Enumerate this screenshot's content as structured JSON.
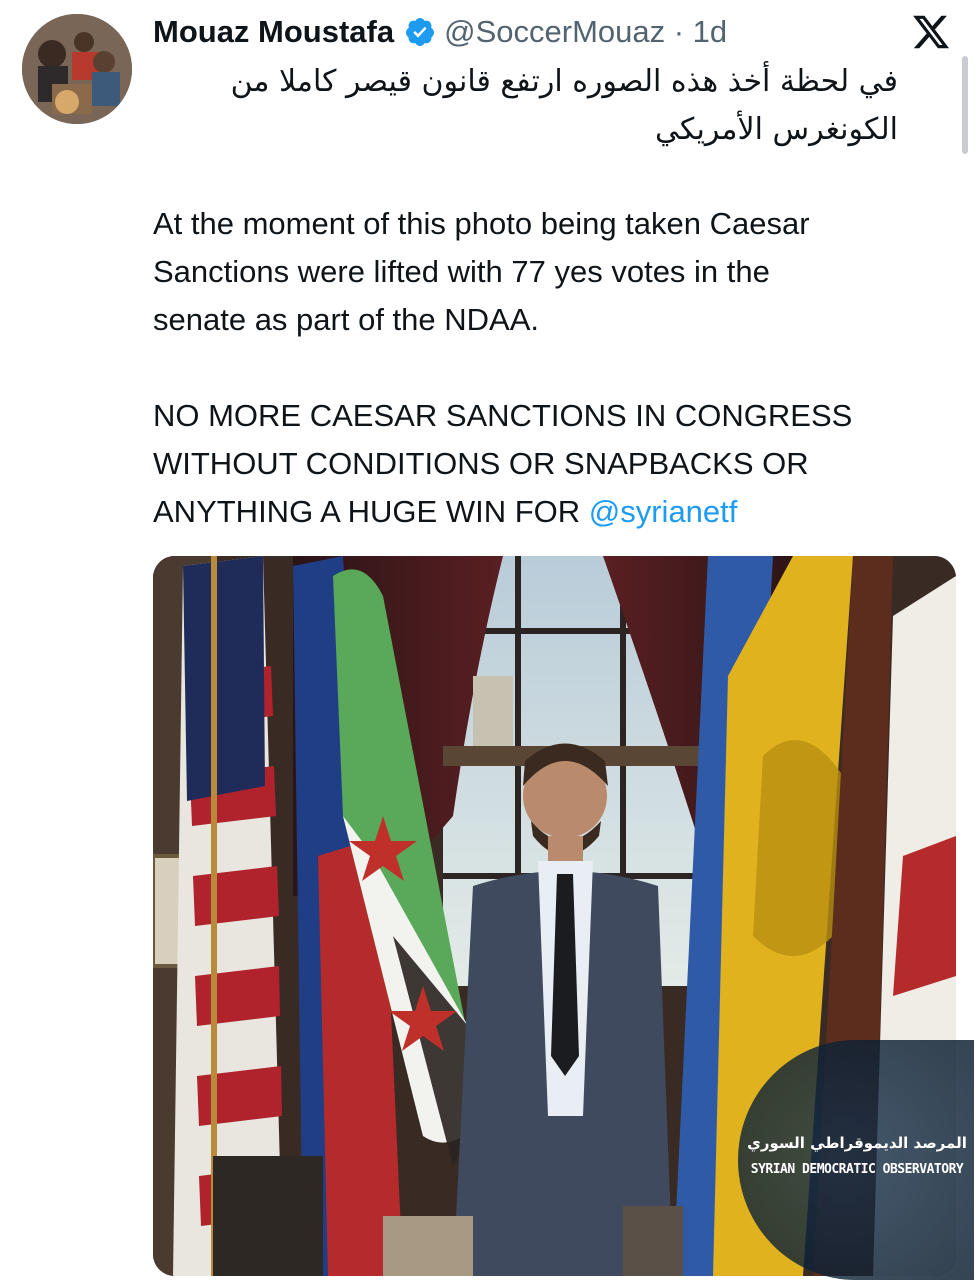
{
  "tweet": {
    "author_name": "Mouaz Moustafa",
    "handle_time": "@SoccerMouaz · 1d",
    "arabic_text": "في لحظة أخذ هذه الصوره ارتفع قانون قيصر كاملا من الكونغرس الأمريكي",
    "english_line_1": "At the moment of this photo being taken Caesar",
    "english_line_2": "Sanctions were lifted with 77 yes votes in the",
    "english_line_3": "senate as part of the NDAA.",
    "caps_line_1": "NO MORE CAESAR SANCTIONS IN CONGRESS",
    "caps_line_2": "WITHOUT CONDITIONS OR SNAPBACKS OR",
    "caps_line_3": "ANYTHING A HUGE WIN FOR ",
    "mention": "@syrianetf"
  },
  "icons": {
    "verified": "verified-badge-icon",
    "platform": "x-logo-icon"
  },
  "watermark": {
    "arabic": "المرصد الديموقراطي السوري",
    "english": "SYRIAN DEMOCRATIC OBSERVATORY"
  },
  "colors": {
    "text": "#0f1419",
    "secondary": "#536471",
    "accent": "#1d9bf0"
  }
}
